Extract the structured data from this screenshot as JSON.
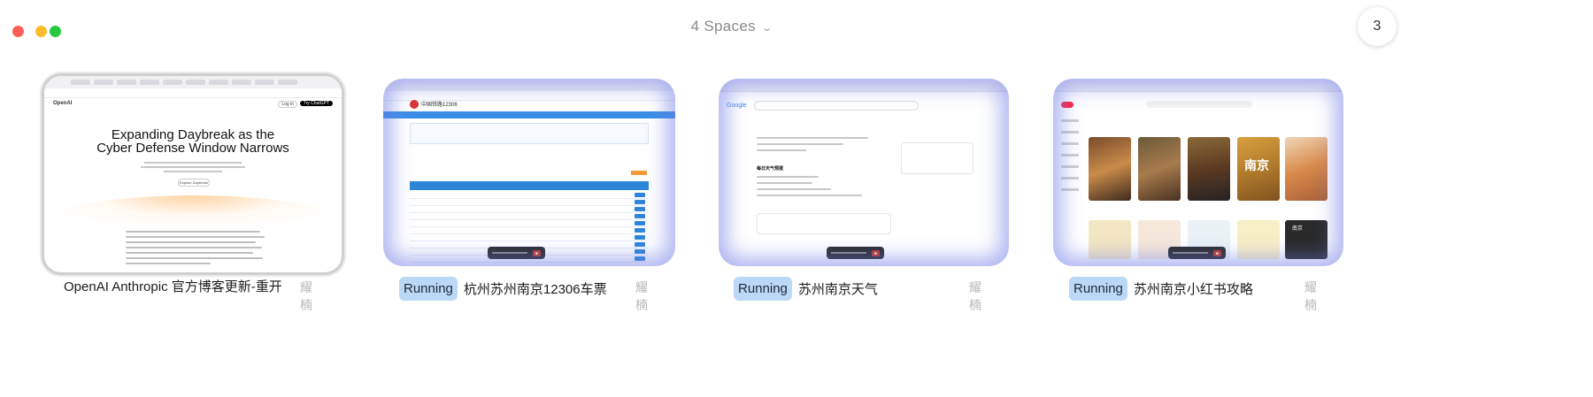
{
  "header": {
    "title": "4 Spaces",
    "counter": "3"
  },
  "spaces": [
    {
      "title": "OpenAI Anthropic 官方博客更新-重开",
      "status": "",
      "owner": "耀楠",
      "preview": {
        "site_logo": "OpenAI",
        "login_label": "Log in",
        "cta_label": "Try ChatGPT",
        "headline_line1": "Expanding Daybreak as the",
        "headline_line2": "Cyber Defense Window Narrows",
        "button_label": "Explore Daybreak"
      }
    },
    {
      "title": "杭州苏州南京12306车票",
      "status": "Running",
      "owner": "耀楠",
      "preview": {
        "site_logo": "中国铁路12306"
      }
    },
    {
      "title": "苏州南京天气",
      "status": "Running",
      "owner": "耀楠",
      "preview": {
        "site_logo": "Google",
        "section_heading": "每日天气预报"
      }
    },
    {
      "title": "苏州南京小红书攻略",
      "status": "Running",
      "owner": "耀楠",
      "preview": {
        "tile_text_1": "南京",
        "tile_text_2": "南京"
      }
    }
  ],
  "colors": {
    "running_badge_bg": "#bcd8f7",
    "traffic_red": "#ff5f57",
    "traffic_yellow": "#febc2e",
    "traffic_green": "#28c840",
    "running_glow": "#707ce6"
  }
}
